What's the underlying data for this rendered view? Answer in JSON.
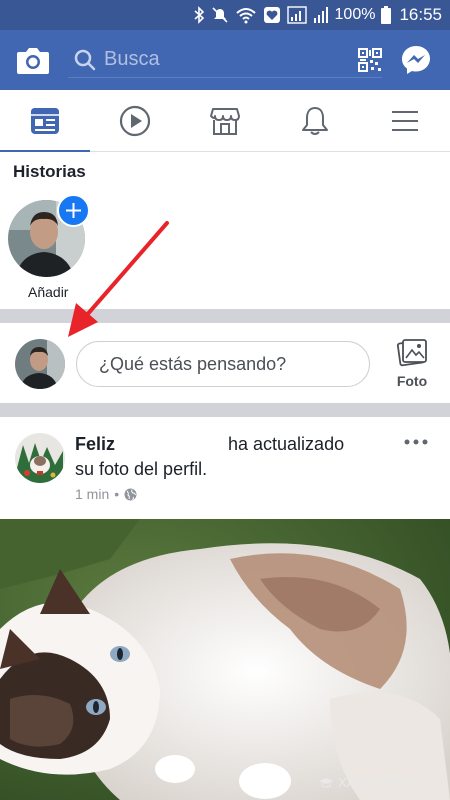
{
  "status_bar": {
    "battery_percent": "100%",
    "time": "16:55"
  },
  "header": {
    "search_placeholder": "Busca",
    "brand_color": "#4267b2"
  },
  "nav": {
    "tabs": [
      {
        "icon": "news-feed-icon",
        "active": true
      },
      {
        "icon": "watch-icon",
        "active": false
      },
      {
        "icon": "marketplace-icon",
        "active": false
      },
      {
        "icon": "bell-icon",
        "active": false
      },
      {
        "icon": "menu-icon",
        "active": false
      }
    ]
  },
  "stories": {
    "title": "Historias",
    "add_label": "Añadir"
  },
  "composer": {
    "placeholder": "¿Qué estás pensando?",
    "photo_label": "Foto"
  },
  "post": {
    "author": "Feliz",
    "action_part1": "ha actualizado",
    "action_part2": "su foto del perfil.",
    "time": "1 min",
    "separator": "•",
    "privacy_icon": "globe-icon"
  },
  "watermark": {
    "text": "XATAKA BASICS"
  },
  "annotation": {
    "arrow_color": "#e8232a"
  }
}
